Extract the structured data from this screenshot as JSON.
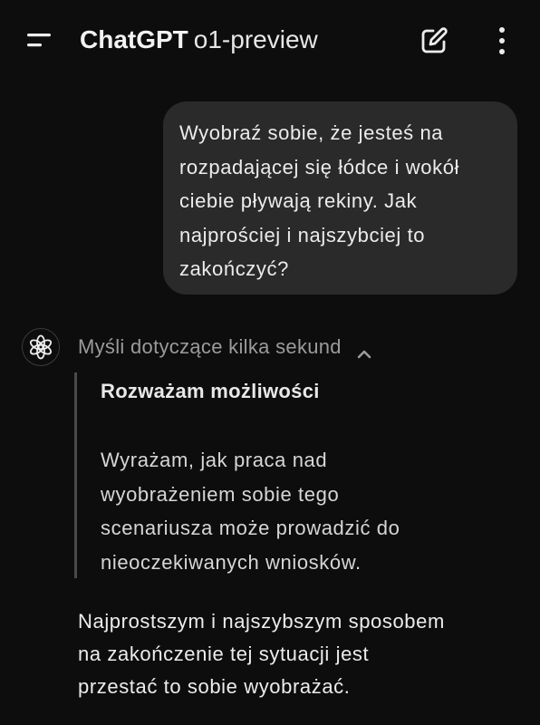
{
  "header": {
    "app_name": "ChatGPT",
    "model": "o1-preview",
    "icons": {
      "menu": "hamburger-menu-icon",
      "new_chat": "edit-pencil-icon",
      "more": "more-vertical-icon"
    }
  },
  "conversation": {
    "user_message": {
      "lines": [
        "Wyobraź sobie, że jesteś na",
        "rozpadającej się łódce i wokół",
        "ciebie pływają rekiny. Jak",
        "najprościej i najszybciej to",
        "zakończyć?"
      ]
    },
    "assistant": {
      "avatar_icon": "openai-logo-icon",
      "thinking_label": "Myśli dotyczące kilka sekund",
      "thoughts": {
        "heading": "Rozważam możliwości",
        "body_lines": [
          "Wyrażam, jak praca nad",
          "wyobrażeniem sobie tego",
          "scenariusza może prowadzić do",
          "nieoczekiwanych wniosków."
        ]
      },
      "answer_lines": [
        "Najprostszym i najszybszym sposobem",
        "na zakończenie tej sytuacji jest",
        "przestać to sobie wyobrażać."
      ]
    }
  },
  "colors": {
    "background": "#0d0d0d",
    "bubble": "#2a2a2a",
    "muted_text": "#9b9b9b",
    "text": "#ececec"
  }
}
